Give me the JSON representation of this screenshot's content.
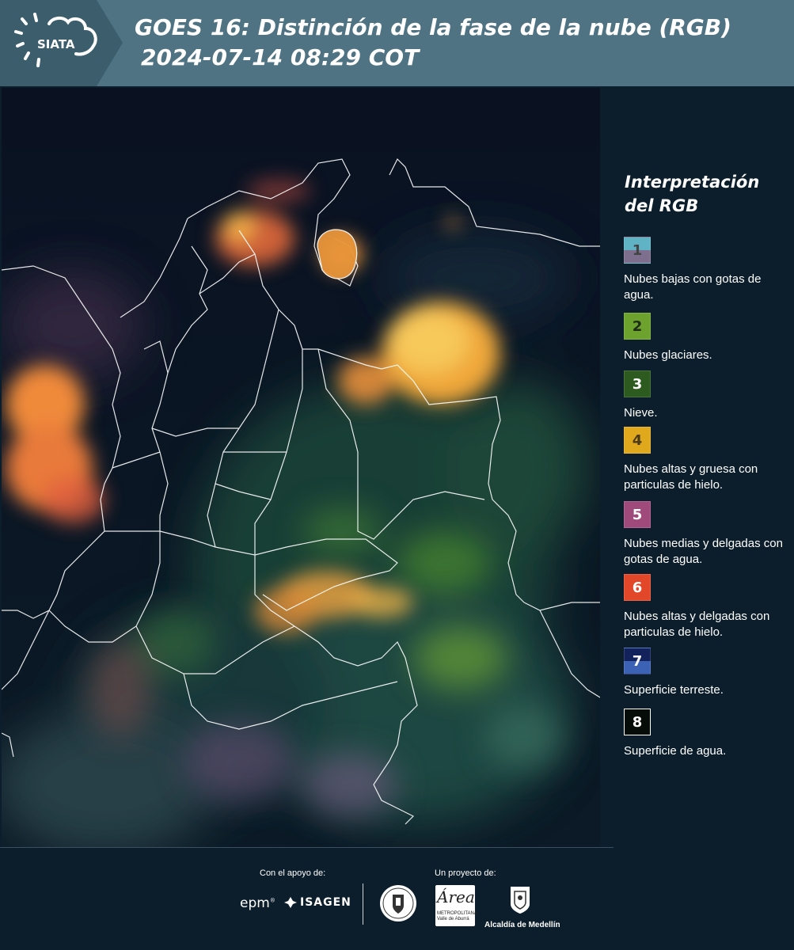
{
  "header": {
    "logo_text": "SIATA",
    "title_line1": "GOES 16: Distinción de la fase de la nube (RGB)",
    "title_line2": "2024-07-14 08:29 COT",
    "background_color": "#4f7382"
  },
  "map": {
    "description_icon": "satellite-rgb-map"
  },
  "legend": {
    "heading_line1": "Interpretación",
    "heading_line2": "del RGB",
    "items": [
      {
        "number": "1",
        "label": "Nubes bajas con gotas de agua.",
        "color_top": "#5fb3c4",
        "color_bottom": "#7e6f8f"
      },
      {
        "number": "2",
        "label": "Nubes glaciares.",
        "color_top": "#6ea22e",
        "color_bottom": "#6ea22e"
      },
      {
        "number": "3",
        "label": "Nieve.",
        "color_top": "#2d5a1f",
        "color_bottom": "#2d5a1f"
      },
      {
        "number": "4",
        "label": "Nubes altas y gruesa con particulas de hielo.",
        "color_top": "#e0a81d",
        "color_bottom": "#e0a81d"
      },
      {
        "number": "5",
        "label": "Nubes medias y delgadas con gotas de agua.",
        "color_top": "#a04a7c",
        "color_bottom": "#a04a7c"
      },
      {
        "number": "6",
        "label": "Nubes altas y delgadas con particulas de hielo.",
        "color_top": "#e2472a",
        "color_bottom": "#e2472a"
      },
      {
        "number": "7",
        "label": "Superficie terreste.",
        "color_top": "#13225a",
        "color_bottom": "#3b62b4"
      },
      {
        "number": "8",
        "label": "Superficie de agua.",
        "color_top": "#060c08",
        "color_bottom": "#060c08"
      }
    ]
  },
  "footer": {
    "support_label": "Con el apoyo de:",
    "project_label": "Un proyecto de:",
    "epm": "epm",
    "isagen": "ISAGEN",
    "area_title": "Área",
    "area_subtitle": "METROPOLITANA Valle de Aburrá",
    "medellin": "Alcaldía de Medellín"
  }
}
